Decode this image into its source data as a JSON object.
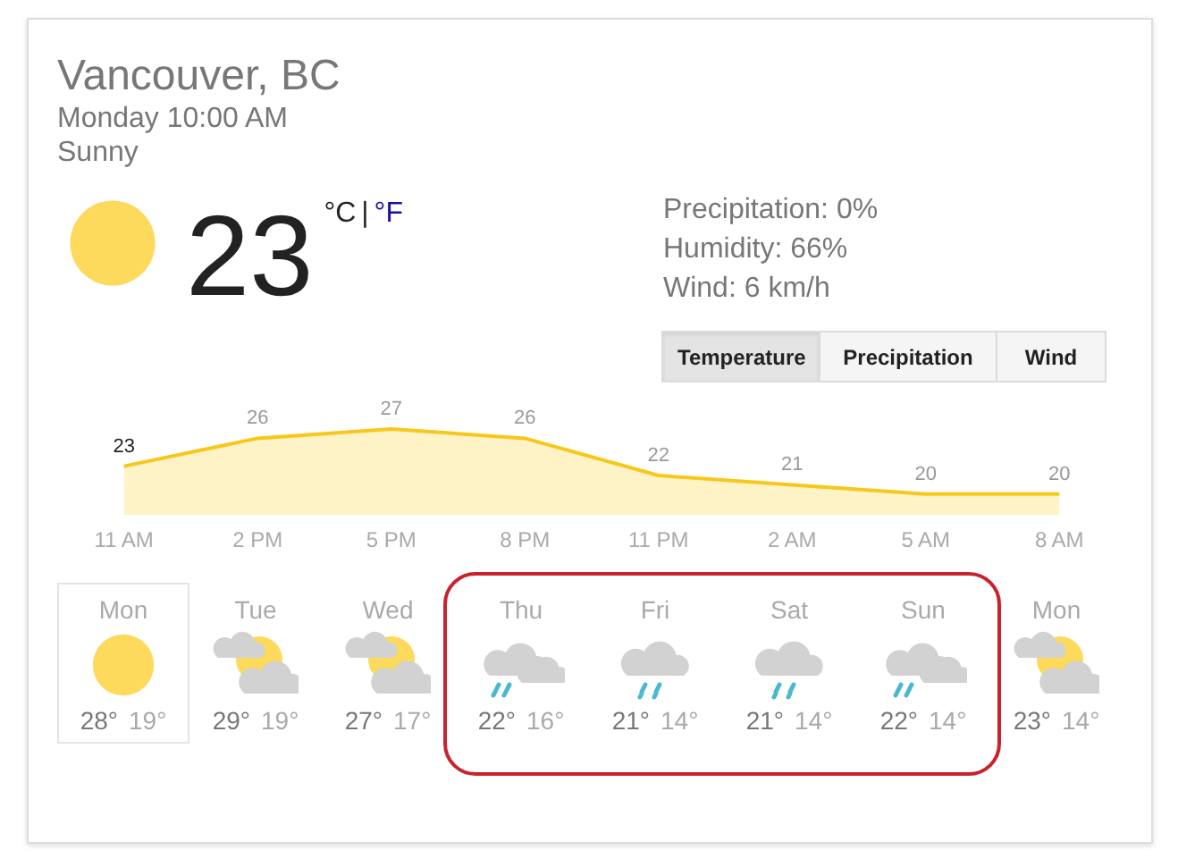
{
  "location": "Vancouver, BC",
  "time": "Monday 10:00 AM",
  "condition": "Sunny",
  "current": {
    "kind": "sunny",
    "temperature": "23",
    "unit_c": "°C",
    "separator": "|",
    "unit_f": "°F"
  },
  "details": [
    "Precipitation: 0%",
    "Humidity: 66%",
    "Wind: 6 km/h"
  ],
  "tabs": [
    {
      "label": "Temperature",
      "selected": true
    },
    {
      "label": "Precipitation",
      "selected": false
    },
    {
      "label": "Wind",
      "selected": false
    }
  ],
  "chart_data": {
    "type": "area",
    "categories": [
      "11 AM",
      "2 PM",
      "5 PM",
      "8 PM",
      "11 PM",
      "2 AM",
      "5 AM",
      "8 AM"
    ],
    "values": [
      23,
      26,
      27,
      26,
      22,
      21,
      20,
      20
    ],
    "data_labels": true
  },
  "days": [
    {
      "name": "Mon",
      "kind": "sunny",
      "high": "28°",
      "low": "19°",
      "selected": true,
      "highlighted": false
    },
    {
      "name": "Tue",
      "kind": "partly-cloudy",
      "high": "29°",
      "low": "19°",
      "selected": false,
      "highlighted": false
    },
    {
      "name": "Wed",
      "kind": "partly-cloudy",
      "high": "27°",
      "low": "17°",
      "selected": false,
      "highlighted": false
    },
    {
      "name": "Thu",
      "kind": "showers",
      "high": "22°",
      "low": "16°",
      "selected": false,
      "highlighted": true
    },
    {
      "name": "Fri",
      "kind": "rain",
      "high": "21°",
      "low": "14°",
      "selected": false,
      "highlighted": true
    },
    {
      "name": "Sat",
      "kind": "rain",
      "high": "21°",
      "low": "14°",
      "selected": false,
      "highlighted": true
    },
    {
      "name": "Sun",
      "kind": "showers",
      "high": "22°",
      "low": "14°",
      "selected": false,
      "highlighted": true
    },
    {
      "name": "Mon",
      "kind": "partly-cloudy",
      "high": "23°",
      "low": "14°",
      "selected": false,
      "highlighted": false
    }
  ]
}
